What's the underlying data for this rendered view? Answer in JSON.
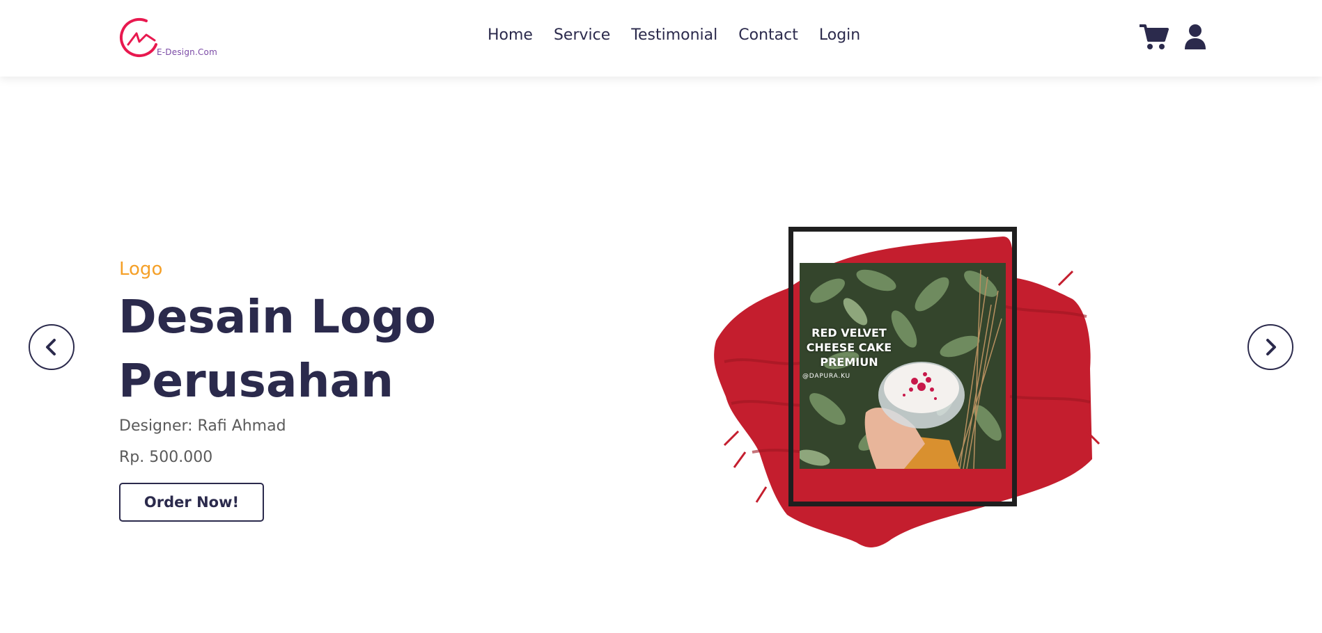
{
  "brand": {
    "name": "E-Design.Com",
    "logo_icon": "swoosh-logo-icon",
    "logo_color": "#e8194f"
  },
  "nav": {
    "items": [
      {
        "label": "Home"
      },
      {
        "label": "Service"
      },
      {
        "label": "Testimonial"
      },
      {
        "label": "Contact"
      },
      {
        "label": "Login"
      }
    ],
    "icons": [
      "cart-icon",
      "user-icon"
    ]
  },
  "hero": {
    "subtitle": "Logo",
    "title": "Desain Logo Perusahan",
    "designer": "Designer: Rafi Ahmad",
    "price": "Rp. 500.000",
    "cta_label": "Order Now!",
    "image": {
      "caption": "RED VELVET CHEESE CAKE PREMIUN",
      "handle": "@DAPURA.KU"
    }
  },
  "carousel": {
    "prev_icon": "chevron-left-icon",
    "next_icon": "chevron-right-icon"
  },
  "colors": {
    "primary": "#2b2a4c",
    "accent": "#f5a028",
    "brand_pink": "#e8194f",
    "brush_red": "#c41e2e"
  }
}
